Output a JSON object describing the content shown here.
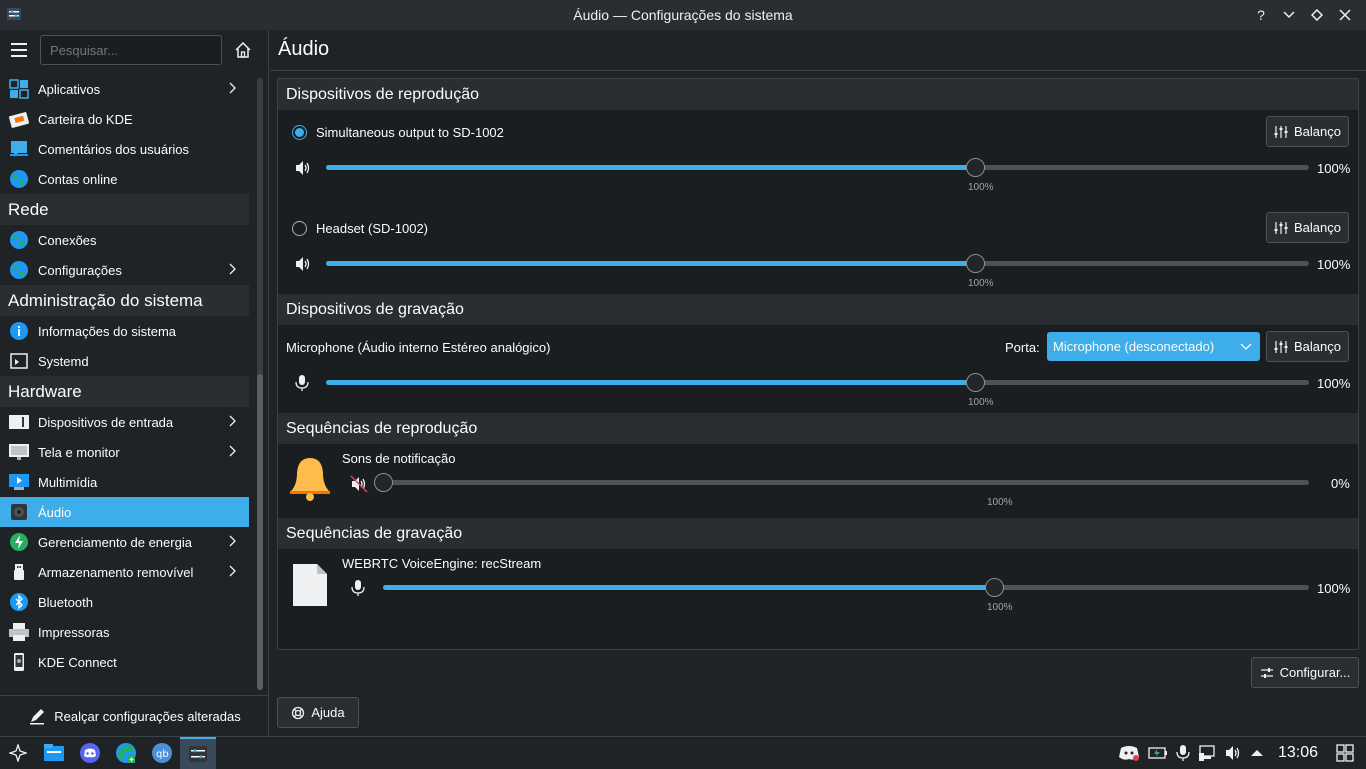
{
  "window": {
    "title": "Áudio — Configurações do sistema"
  },
  "sidebar": {
    "search_placeholder": "Pesquisar...",
    "items": [
      {
        "label": "Aplicativos",
        "icon": "apps-icon",
        "chevron": true,
        "color": "#3daee9"
      },
      {
        "label": "Carteira do KDE",
        "icon": "wallet-icon",
        "chevron": false,
        "color": "#f67400"
      },
      {
        "label": "Comentários dos usuários",
        "icon": "feedback-icon",
        "chevron": false,
        "color": "#3daee9"
      },
      {
        "label": "Contas online",
        "icon": "globe-icon",
        "chevron": false,
        "color": "#27ae60"
      }
    ],
    "category_rede": "Rede",
    "rede_items": [
      {
        "label": "Conexões",
        "icon": "globe-icon",
        "chevron": false
      },
      {
        "label": "Configurações",
        "icon": "globe-icon",
        "chevron": true
      }
    ],
    "category_admin": "Administração do sistema",
    "admin_items": [
      {
        "label": "Informações do sistema",
        "icon": "info-icon",
        "chevron": false
      },
      {
        "label": "Systemd",
        "icon": "systemd-icon",
        "chevron": false
      }
    ],
    "category_hardware": "Hardware",
    "hardware_items": [
      {
        "label": "Dispositivos de entrada",
        "icon": "keyboard-icon",
        "chevron": true
      },
      {
        "label": "Tela e monitor",
        "icon": "monitor-icon",
        "chevron": true
      },
      {
        "label": "Multimídia",
        "icon": "multimedia-icon",
        "chevron": false
      },
      {
        "label": "Áudio",
        "icon": "speaker-icon",
        "chevron": false,
        "active": true
      },
      {
        "label": "Gerenciamento de energia",
        "icon": "power-icon",
        "chevron": true
      },
      {
        "label": "Armazenamento removível",
        "icon": "usb-icon",
        "chevron": true
      },
      {
        "label": "Bluetooth",
        "icon": "bluetooth-icon",
        "chevron": false
      },
      {
        "label": "Impressoras",
        "icon": "printer-icon",
        "chevron": false
      },
      {
        "label": "KDE Connect",
        "icon": "kdeconnect-icon",
        "chevron": false
      }
    ],
    "highlight_changed": "Realçar configurações alteradas"
  },
  "main": {
    "title": "Áudio",
    "playback_header": "Dispositivos de reprodução",
    "playback_devices": [
      {
        "name": "Simultaneous output to SD-1002",
        "selected": true,
        "volume": "100%",
        "tick": "100%",
        "level": 0.66
      },
      {
        "name": "Headset (SD-1002)",
        "selected": false,
        "volume": "100%",
        "tick": "100%",
        "level": 0.66
      }
    ],
    "balance_label": "Balanço",
    "recording_header": "Dispositivos de gravação",
    "recording_device": {
      "name": "Microphone (Áudio interno Estéreo analógico)",
      "port_label": "Porta:",
      "port_value": "Microphone (desconectado)",
      "volume": "100%",
      "tick": "100%",
      "level": 0.66
    },
    "playback_streams_header": "Sequências de reprodução",
    "playback_stream": {
      "name": "Sons de notificação",
      "volume": "0%",
      "tick": "100%",
      "level": 0.0
    },
    "recording_streams_header": "Sequências de gravação",
    "recording_stream": {
      "name": "WEBRTC VoiceEngine: recStream",
      "volume": "100%",
      "tick": "100%",
      "level": 0.66
    },
    "configure_button": "Configurar...",
    "help_button": "Ajuda"
  },
  "taskbar": {
    "clock": "13:06"
  },
  "colors": {
    "accent": "#3daee9",
    "background": "#202326",
    "panel": "#1b1e20",
    "header": "#2a2e32"
  }
}
